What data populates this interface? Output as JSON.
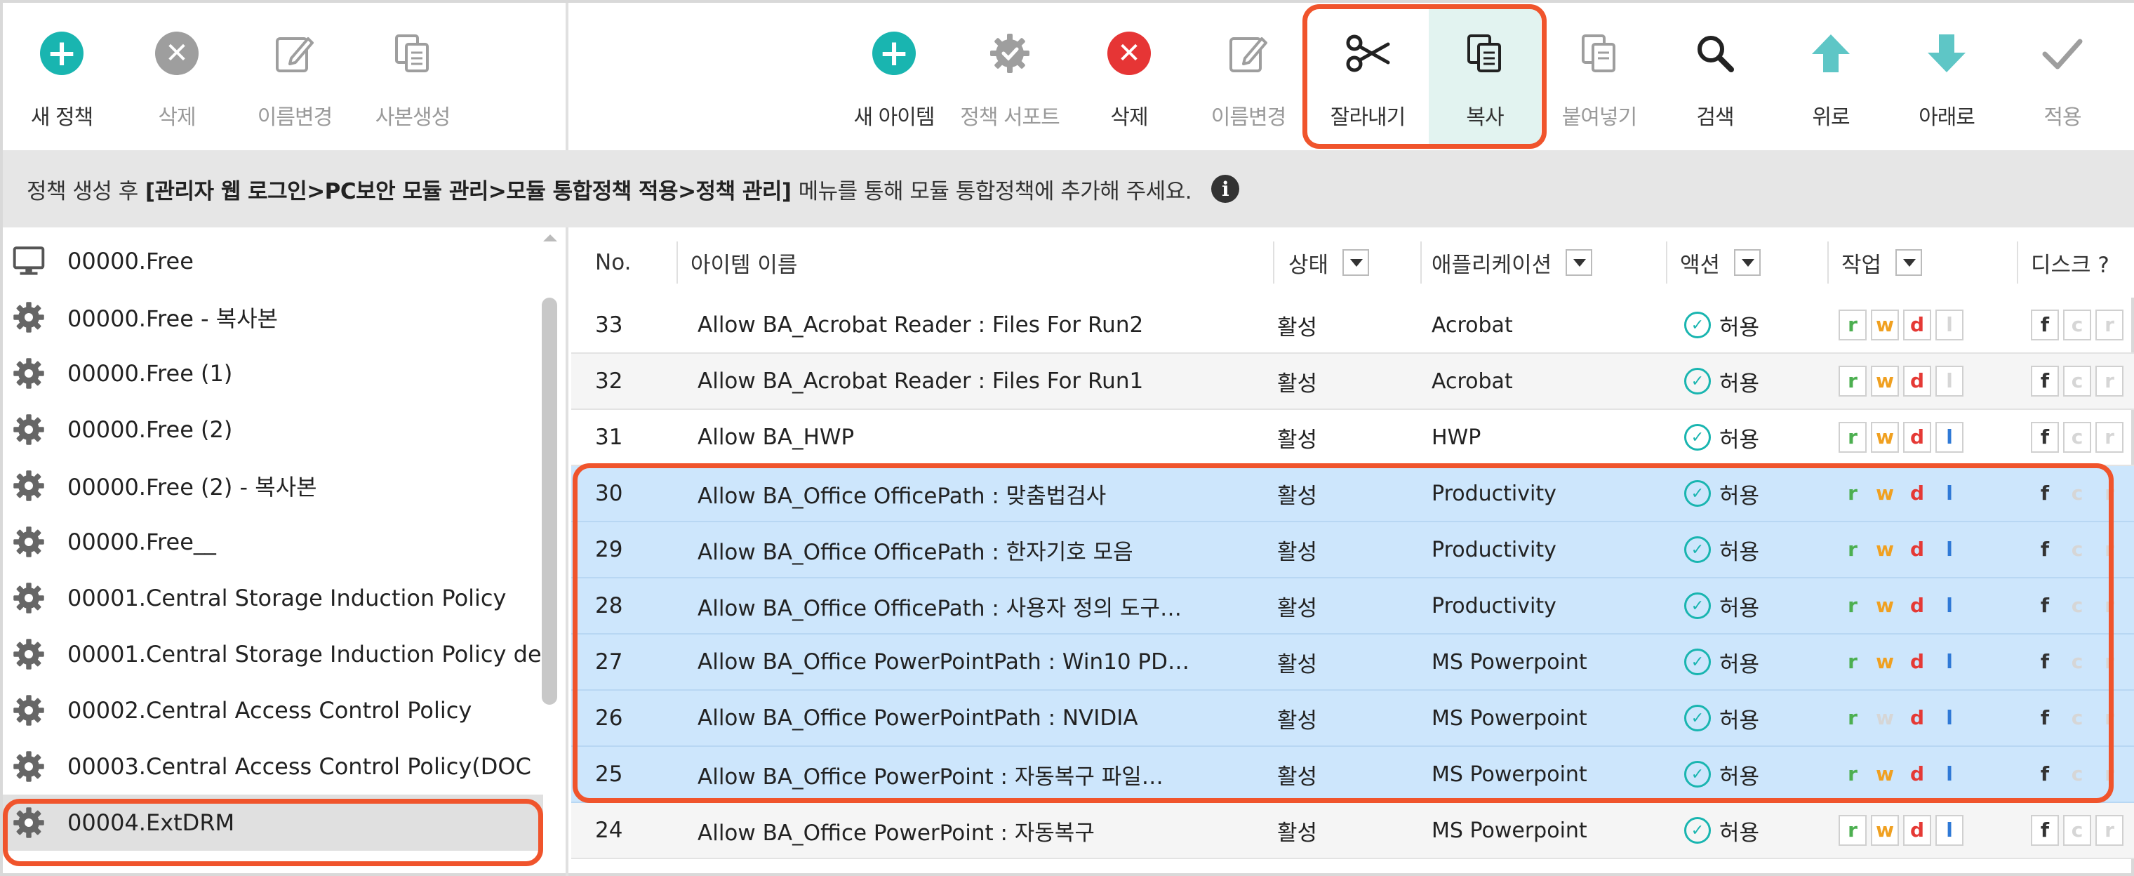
{
  "left_toolbar": [
    {
      "label": "새 정책",
      "icon": "plus-circle-icon",
      "enabled": true
    },
    {
      "label": "삭제",
      "icon": "close-circle-icon",
      "enabled": false
    },
    {
      "label": "이름변경",
      "icon": "edit-icon",
      "enabled": false
    },
    {
      "label": "사본생성",
      "icon": "copy-icon",
      "enabled": false
    }
  ],
  "right_toolbar": [
    {
      "label": "새 아이템",
      "icon": "plus-circle-icon",
      "enabled": true
    },
    {
      "label": "정책 서포트",
      "icon": "gear-check-icon",
      "enabled": false
    },
    {
      "label": "삭제",
      "icon": "close-circle-icon",
      "enabled": true
    },
    {
      "label": "이름변경",
      "icon": "edit-icon",
      "enabled": false
    },
    {
      "label": "잘라내기",
      "icon": "scissors-icon",
      "enabled": true
    },
    {
      "label": "복사",
      "icon": "copy-icon",
      "enabled": true,
      "active": true
    },
    {
      "label": "붙여넣기",
      "icon": "paste-icon",
      "enabled": false
    },
    {
      "label": "검색",
      "icon": "search-icon",
      "enabled": true
    },
    {
      "label": "위로",
      "icon": "arrow-up-icon",
      "enabled": true
    },
    {
      "label": "아래로",
      "icon": "arrow-down-icon",
      "enabled": true
    },
    {
      "label": "적용",
      "icon": "checkmark-icon",
      "enabled": false
    }
  ],
  "info": {
    "prefix": "정책 생성 후",
    "path": "[관리자 웹 로그인>PC보안 모듈 관리>모듈 통합정책 적용>정책 관리]",
    "suffix": "메뉴를 통해 모듈 통합정책에 추가해 주세요."
  },
  "policies": [
    {
      "name": "00000.Free",
      "icon": "monitor-icon"
    },
    {
      "name": "00000.Free - 복사본",
      "icon": "gear-icon"
    },
    {
      "name": "00000.Free (1)",
      "icon": "gear-icon"
    },
    {
      "name": "00000.Free (2)",
      "icon": "gear-icon"
    },
    {
      "name": "00000.Free (2) - 복사본",
      "icon": "gear-icon"
    },
    {
      "name": "00000.Free__",
      "icon": "gear-icon"
    },
    {
      "name": "00001.Central Storage Induction Policy",
      "icon": "gear-icon"
    },
    {
      "name": "00001.Central Storage Induction Policy de",
      "icon": "gear-icon"
    },
    {
      "name": "00002.Central Access Control Policy",
      "icon": "gear-icon"
    },
    {
      "name": "00003.Central Access Control Policy(DOC",
      "icon": "gear-icon"
    },
    {
      "name": "00004.ExtDRM",
      "icon": "gear-icon",
      "selected": true
    }
  ],
  "table": {
    "columns": {
      "no": "No.",
      "name": "아이템 이름",
      "status": "상태",
      "app": "애플리케이션",
      "action": "액션",
      "work": "작업",
      "disk": "디스크 ?"
    },
    "rows": [
      {
        "no": "33",
        "name": "Allow BA_Acrobat Reader : Files For Run2",
        "status": "활성",
        "app": "Acrobat",
        "action": "허용",
        "perms": [
          "r",
          "w",
          "d",
          "l"
        ],
        "perm_on": [
          true,
          true,
          true,
          false
        ],
        "disk": [
          "f",
          "c",
          "r"
        ],
        "disk_on": [
          true,
          false,
          false
        ],
        "selected": false
      },
      {
        "no": "32",
        "name": "Allow BA_Acrobat Reader : Files For Run1",
        "status": "활성",
        "app": "Acrobat",
        "action": "허용",
        "perms": [
          "r",
          "w",
          "d",
          "l"
        ],
        "perm_on": [
          true,
          true,
          true,
          false
        ],
        "disk": [
          "f",
          "c",
          "r"
        ],
        "disk_on": [
          true,
          false,
          false
        ],
        "selected": false
      },
      {
        "no": "31",
        "name": "Allow BA_HWP",
        "status": "활성",
        "app": "HWP",
        "action": "허용",
        "perms": [
          "r",
          "w",
          "d",
          "l"
        ],
        "perm_on": [
          true,
          true,
          true,
          true
        ],
        "disk": [
          "f",
          "c",
          "r"
        ],
        "disk_on": [
          true,
          false,
          false
        ],
        "selected": false
      },
      {
        "no": "30",
        "name": "Allow BA_Office OfficePath : 맞춤법검사",
        "status": "활성",
        "app": "Productivity",
        "action": "허용",
        "perms": [
          "r",
          "w",
          "d",
          "l"
        ],
        "perm_on": [
          true,
          true,
          true,
          true
        ],
        "disk": [
          "f",
          "c",
          "r"
        ],
        "disk_on": [
          true,
          false,
          false
        ],
        "selected": true
      },
      {
        "no": "29",
        "name": "Allow BA_Office OfficePath : 한자기호 모음",
        "status": "활성",
        "app": "Productivity",
        "action": "허용",
        "perms": [
          "r",
          "w",
          "d",
          "l"
        ],
        "perm_on": [
          true,
          true,
          true,
          true
        ],
        "disk": [
          "f",
          "c",
          "r"
        ],
        "disk_on": [
          true,
          false,
          false
        ],
        "selected": true
      },
      {
        "no": "28",
        "name": "Allow BA_Office OfficePath : 사용자 정의 도구…",
        "status": "활성",
        "app": "Productivity",
        "action": "허용",
        "perms": [
          "r",
          "w",
          "d",
          "l"
        ],
        "perm_on": [
          true,
          true,
          true,
          true
        ],
        "disk": [
          "f",
          "c",
          "r"
        ],
        "disk_on": [
          true,
          false,
          false
        ],
        "selected": true
      },
      {
        "no": "27",
        "name": "Allow BA_Office PowerPointPath : Win10 PD…",
        "status": "활성",
        "app": "MS Powerpoint",
        "action": "허용",
        "perms": [
          "r",
          "w",
          "d",
          "l"
        ],
        "perm_on": [
          true,
          true,
          true,
          true
        ],
        "disk": [
          "f",
          "c",
          "r"
        ],
        "disk_on": [
          true,
          false,
          false
        ],
        "selected": true
      },
      {
        "no": "26",
        "name": "Allow BA_Office PowerPointPath : NVIDIA",
        "status": "활성",
        "app": "MS Powerpoint",
        "action": "허용",
        "perms": [
          "r",
          "w",
          "d",
          "l"
        ],
        "perm_on": [
          true,
          false,
          true,
          true
        ],
        "disk": [
          "f",
          "c",
          "r"
        ],
        "disk_on": [
          true,
          false,
          false
        ],
        "selected": true
      },
      {
        "no": "25",
        "name": "Allow BA_Office PowerPoint : 자동복구 파일…",
        "status": "활성",
        "app": "MS Powerpoint",
        "action": "허용",
        "perms": [
          "r",
          "w",
          "d",
          "l"
        ],
        "perm_on": [
          true,
          true,
          true,
          true
        ],
        "disk": [
          "f",
          "c",
          "r"
        ],
        "disk_on": [
          true,
          false,
          false
        ],
        "selected": true
      },
      {
        "no": "24",
        "name": "Allow BA_Office PowerPoint : 자동복구",
        "status": "활성",
        "app": "MS Powerpoint",
        "action": "허용",
        "perms": [
          "r",
          "w",
          "d",
          "l"
        ],
        "perm_on": [
          true,
          true,
          true,
          true
        ],
        "disk": [
          "f",
          "c",
          "r"
        ],
        "disk_on": [
          true,
          false,
          false
        ],
        "selected": false
      }
    ]
  },
  "colors": {
    "accent_teal": "#19b5b0",
    "delete_red": "#e63535",
    "selection_blue": "#cde6fc",
    "highlight_orange": "#f0542c"
  }
}
